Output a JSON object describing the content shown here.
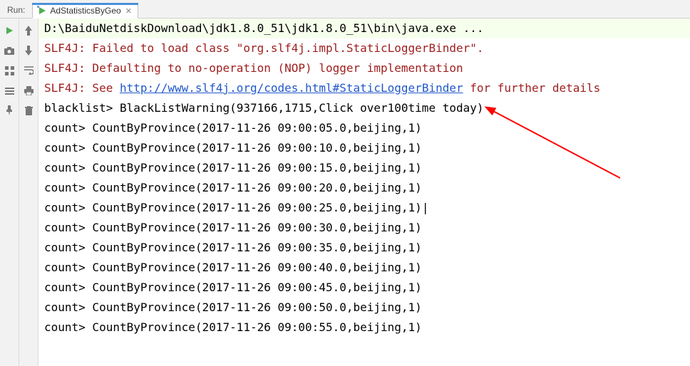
{
  "header": {
    "panel_label": "Run:",
    "tab_label": "AdStatisticsByGeo"
  },
  "console": {
    "exec_line": "D:\\BaiduNetdiskDownload\\jdk1.8.0_51\\jdk1.8.0_51\\bin\\java.exe ...",
    "slf4j_1_prefix": "SLF4J: Failed to load class \"org.slf4j.impl.StaticLoggerBinder\".",
    "slf4j_2": "SLF4J: Defaulting to no-operation (NOP) logger implementation",
    "slf4j_3_prefix": "SLF4J: See ",
    "slf4j_3_link": "http://www.slf4j.org/codes.html#StaticLoggerBinder",
    "slf4j_3_suffix": " for further details",
    "blacklist_line": "blacklist> BlackListWarning(937166,1715,Click over100time today)",
    "counts": [
      "count> CountByProvince(2017-11-26 09:00:05.0,beijing,1)",
      "count> CountByProvince(2017-11-26 09:00:10.0,beijing,1)",
      "count> CountByProvince(2017-11-26 09:00:15.0,beijing,1)",
      "count> CountByProvince(2017-11-26 09:00:20.0,beijing,1)",
      "count> CountByProvince(2017-11-26 09:00:25.0,beijing,1)",
      "count> CountByProvince(2017-11-26 09:00:30.0,beijing,1)",
      "count> CountByProvince(2017-11-26 09:00:35.0,beijing,1)",
      "count> CountByProvince(2017-11-26 09:00:40.0,beijing,1)",
      "count> CountByProvince(2017-11-26 09:00:45.0,beijing,1)",
      "count> CountByProvince(2017-11-26 09:00:50.0,beijing,1)",
      "count> CountByProvince(2017-11-26 09:00:55.0,beijing,1)"
    ],
    "caret_index": 4
  },
  "icons": {
    "run_config": "run-config-icon",
    "close": "close-icon",
    "rerun": "rerun-icon",
    "camera": "camera-icon",
    "layout": "layout-icon",
    "collapse": "collapse-icon",
    "pin": "pin-icon",
    "scroll_up": "scroll-up-icon",
    "scroll_down": "scroll-down-icon",
    "wrap": "wrap-icon",
    "print": "print-icon",
    "delete": "delete-icon"
  },
  "colors": {
    "accent": "#4a90d9",
    "highlight_bg": "#f6ffec",
    "err_text": "#a02020",
    "link": "#2158ca",
    "arrow": "#ff0000"
  }
}
